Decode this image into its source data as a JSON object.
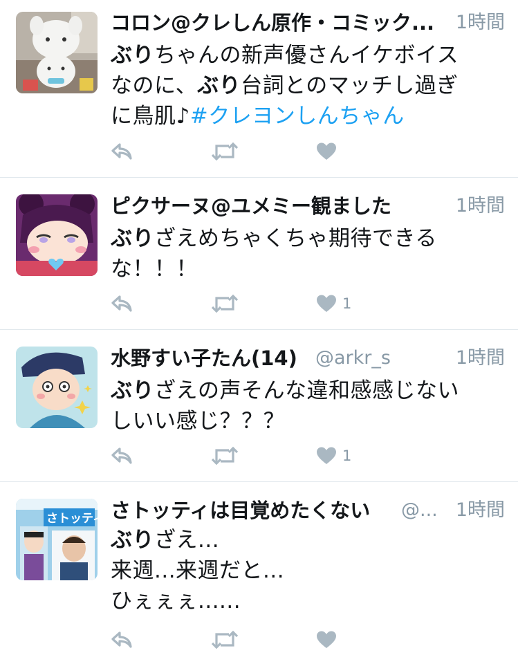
{
  "tweets": [
    {
      "name": "コロン@クレしん原作・コミック...",
      "handle": "",
      "time": "1時間",
      "lines": [
        [
          {
            "t": "ぶり",
            "s": "hl"
          },
          {
            "t": "ちゃんの新声優さんイケボイス",
            "s": ""
          }
        ],
        [
          {
            "t": "なのに、",
            "s": ""
          },
          {
            "t": "ぶり",
            "s": "hl"
          },
          {
            "t": "台詞とのマッチし過ぎ",
            "s": ""
          }
        ],
        [
          {
            "t": "に鳥肌♪",
            "s": ""
          },
          {
            "t": "#クレヨンしんちゃん",
            "s": "tag"
          }
        ]
      ],
      "likes": "",
      "avatar": "white-plush-toy-avatar"
    },
    {
      "name": "ピクサーヌ@ユメミー観ました",
      "handle": "",
      "time": "1時間",
      "lines": [
        [
          {
            "t": "ぶり",
            "s": "hl"
          },
          {
            "t": "ざえめちゃくちゃ期待できる",
            "s": ""
          }
        ],
        [
          {
            "t": "な！！！",
            "s": ""
          }
        ]
      ],
      "likes": "1",
      "avatar": "purple-hair-character-avatar"
    },
    {
      "name": "水野すい子たん(14)",
      "handle": "@arkr_s",
      "time": "1時間",
      "lines": [
        [
          {
            "t": "ぶり",
            "s": "hl"
          },
          {
            "t": "ざえの声そんな違和感感じない",
            "s": ""
          }
        ],
        [
          {
            "t": "しいい感じ？？？",
            "s": ""
          }
        ]
      ],
      "likes": "1",
      "avatar": "cartoon-character-avatar"
    },
    {
      "name": "さトッティは目覚めたくない",
      "handle": "@...",
      "time": "1時間",
      "lines": [
        [
          {
            "t": "ぶり",
            "s": "hl"
          },
          {
            "t": "ざえ...",
            "s": ""
          }
        ],
        [
          {
            "t": "来週...来週だと...",
            "s": ""
          }
        ],
        [
          {
            "t": "ひぇぇぇ......",
            "s": ""
          }
        ]
      ],
      "likes": "",
      "avatar": "satotty-collage-avatar",
      "avatar_text": "さトッティ"
    }
  ],
  "icons": {
    "reply": "reply-icon",
    "retweet": "retweet-icon",
    "like": "heart-icon"
  },
  "colors": {
    "text": "#14171a",
    "secondary": "#8899a6",
    "hashtag": "#1da1f2",
    "icon": "#aab8c2",
    "divider": "#e1e8ed"
  }
}
